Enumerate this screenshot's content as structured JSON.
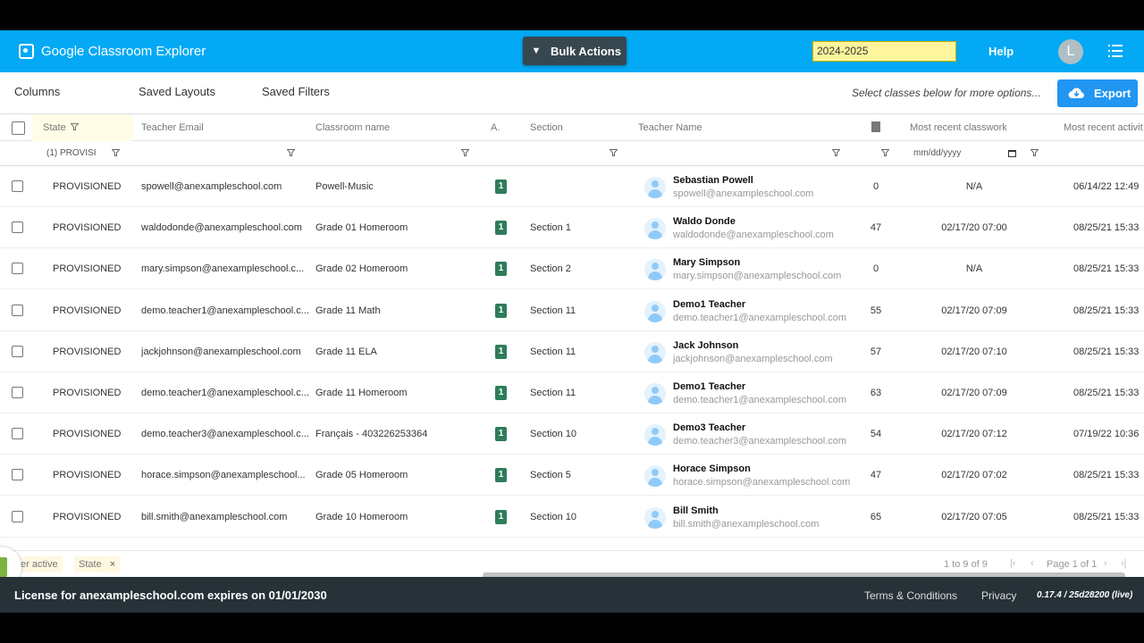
{
  "header": {
    "app_title": "Google Classroom Explorer",
    "bulk_actions_label": "Bulk Actions",
    "school_year": "2024-2025",
    "help_label": "Help",
    "avatar_initial": "L"
  },
  "toolbar": {
    "columns_label": "Columns",
    "saved_layouts_label": "Saved Layouts",
    "saved_filters_label": "Saved Filters",
    "hint": "Select classes below for more options...",
    "export_label": "Export"
  },
  "grid": {
    "columns": {
      "state": "State",
      "teacher_email": "Teacher Email",
      "classroom_name": "Classroom name",
      "a": "A.",
      "section": "Section",
      "teacher_name": "Teacher Name",
      "most_recent_classwork": "Most recent classwork",
      "most_recent_activity": "Most recent activit"
    },
    "filters": {
      "state_value": "(1) PROVISI",
      "date_placeholder": "mm/dd/yyyy"
    },
    "rows": [
      {
        "state": "PROVISIONED",
        "teacher_email": "spowell@anexampleschool.com",
        "classroom": "Powell-Music",
        "a": "1",
        "section": "",
        "teacher_name": "Sebastian Powell",
        "teacher_sub": "spowell@anexampleschool.com",
        "count": "0",
        "classwork": "N/A",
        "activity": "06/14/22 12:49"
      },
      {
        "state": "PROVISIONED",
        "teacher_email": "waldodonde@anexampleschool.com",
        "classroom": "Grade 01 Homeroom",
        "a": "1",
        "section": "Section 1",
        "teacher_name": "Waldo Donde",
        "teacher_sub": "waldodonde@anexampleschool.com",
        "count": "47",
        "classwork": "02/17/20 07:00",
        "activity": "08/25/21 15:33"
      },
      {
        "state": "PROVISIONED",
        "teacher_email": "mary.simpson@anexampleschool.c...",
        "classroom": "Grade 02 Homeroom",
        "a": "1",
        "section": "Section 2",
        "teacher_name": "Mary Simpson",
        "teacher_sub": "mary.simpson@anexampleschool.com",
        "count": "0",
        "classwork": "N/A",
        "activity": "08/25/21 15:33"
      },
      {
        "state": "PROVISIONED",
        "teacher_email": "demo.teacher1@anexampleschool.c...",
        "classroom": "Grade 11 Math",
        "a": "1",
        "section": "Section 11",
        "teacher_name": "Demo1 Teacher",
        "teacher_sub": "demo.teacher1@anexampleschool.com",
        "count": "55",
        "classwork": "02/17/20 07:09",
        "activity": "08/25/21 15:33"
      },
      {
        "state": "PROVISIONED",
        "teacher_email": "jackjohnson@anexampleschool.com",
        "classroom": "Grade 11 ELA",
        "a": "1",
        "section": "Section 11",
        "teacher_name": "Jack Johnson",
        "teacher_sub": "jackjohnson@anexampleschool.com",
        "count": "57",
        "classwork": "02/17/20 07:10",
        "activity": "08/25/21 15:33"
      },
      {
        "state": "PROVISIONED",
        "teacher_email": "demo.teacher1@anexampleschool.c...",
        "classroom": "Grade 11 Homeroom",
        "a": "1",
        "section": "Section 11",
        "teacher_name": "Demo1 Teacher",
        "teacher_sub": "demo.teacher1@anexampleschool.com",
        "count": "63",
        "classwork": "02/17/20 07:09",
        "activity": "08/25/21 15:33"
      },
      {
        "state": "PROVISIONED",
        "teacher_email": "demo.teacher3@anexampleschool.c...",
        "classroom": "Français - 403226253364",
        "a": "1",
        "section": "Section 10",
        "teacher_name": "Demo3 Teacher",
        "teacher_sub": "demo.teacher3@anexampleschool.com",
        "count": "54",
        "classwork": "02/17/20 07:12",
        "activity": "07/19/22 10:36"
      },
      {
        "state": "PROVISIONED",
        "teacher_email": "horace.simpson@anexampleschool...",
        "classroom": "Grade 05 Homeroom",
        "a": "1",
        "section": "Section 5",
        "teacher_name": "Horace Simpson",
        "teacher_sub": "horace.simpson@anexampleschool.com",
        "count": "47",
        "classwork": "02/17/20 07:02",
        "activity": "08/25/21 15:33"
      },
      {
        "state": "PROVISIONED",
        "teacher_email": "bill.smith@anexampleschool.com",
        "classroom": "Grade 10 Homeroom",
        "a": "1",
        "section": "Section 10",
        "teacher_name": "Bill Smith",
        "teacher_sub": "bill.smith@anexampleschool.com",
        "count": "65",
        "classwork": "02/17/20 07:05",
        "activity": "08/25/21 15:33"
      }
    ]
  },
  "status_bar": {
    "filter_tag_1": "er active",
    "filter_tag_2": "State",
    "remove_symbol": "×",
    "rows_summary": "1 to 9 of 9",
    "page_summary": "Page 1 of 1"
  },
  "footer": {
    "license_text": "License for anexampleschool.com expires on 01/01/2030",
    "terms_label": "Terms & Conditions",
    "privacy_label": "Privacy",
    "version": "0.17.4 / 25d28200 (live)"
  },
  "colors": {
    "header_bg": "#03a9f4",
    "bulk_btn_bg": "#37474f",
    "export_bg": "#2196f3",
    "badge_bg": "#2e7d5b",
    "footer_bg": "#263238",
    "year_bg": "#fff59d"
  },
  "icons": {
    "logo": "classroom-logo-icon",
    "menu": "menu-icon",
    "export": "cloud-download-icon",
    "filter": "filter-icon",
    "teacher": "person-icon",
    "bookmark": "bookmark-icon"
  }
}
